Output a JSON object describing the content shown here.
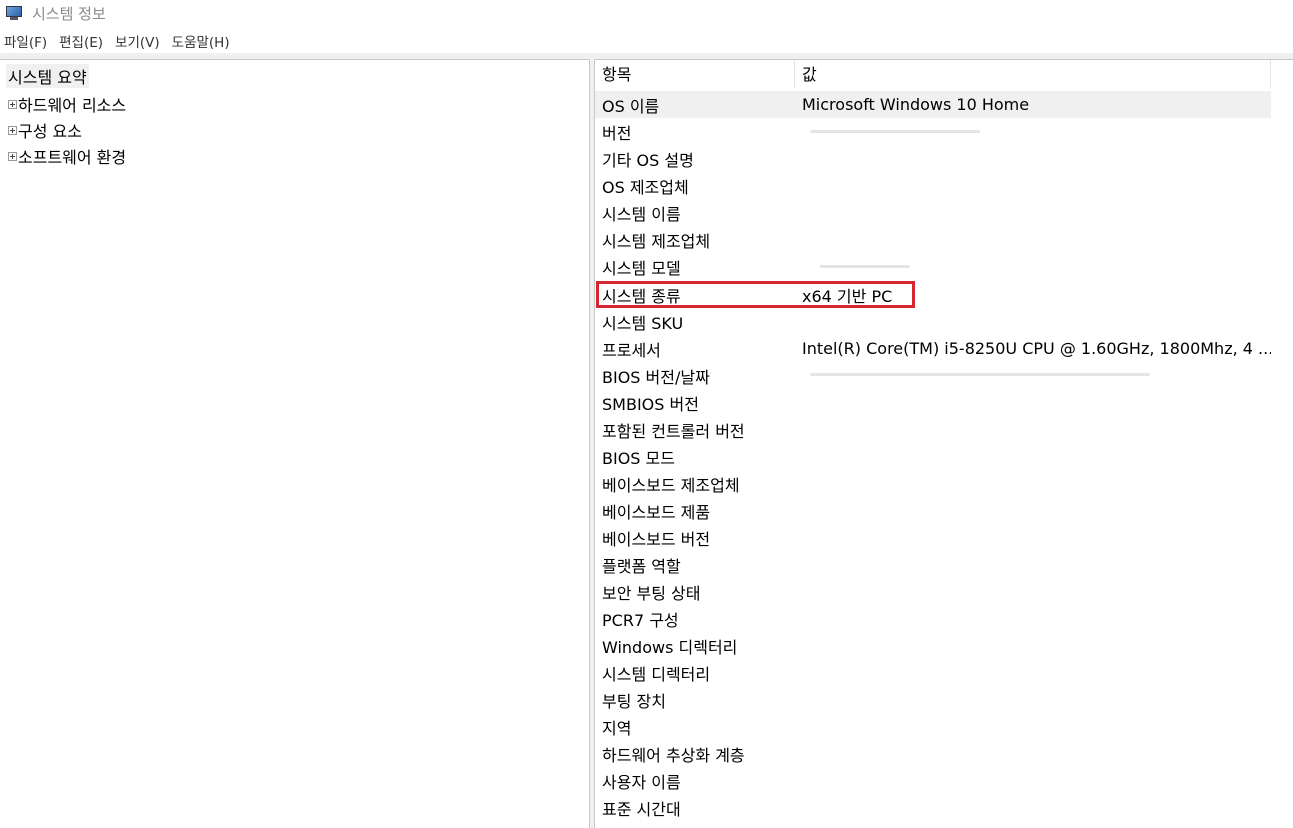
{
  "window": {
    "title": "시스템 정보",
    "icon": "computer-icon"
  },
  "menubar": {
    "items": [
      "파일(F)",
      "편집(E)",
      "보기(V)",
      "도움말(H)"
    ]
  },
  "tree": {
    "root": "시스템 요약",
    "nodes": [
      "하드웨어 리소스",
      "구성 요소",
      "소프트웨어 환경"
    ]
  },
  "table": {
    "columns": {
      "item": "항목",
      "value": "값"
    },
    "rows": [
      {
        "item": "OS 이름",
        "value": "Microsoft Windows 10 Home",
        "selected": true
      },
      {
        "item": "버전",
        "value": ""
      },
      {
        "item": "기타 OS 설명",
        "value": ""
      },
      {
        "item": "OS 제조업체",
        "value": ""
      },
      {
        "item": "시스템 이름",
        "value": ""
      },
      {
        "item": "시스템 제조업체",
        "value": ""
      },
      {
        "item": "시스템 모델",
        "value": ""
      },
      {
        "item": "시스템 종류",
        "value": "x64 기반 PC",
        "highlighted": true
      },
      {
        "item": "시스템 SKU",
        "value": ""
      },
      {
        "item": "프로세서",
        "value": "Intel(R) Core(TM) i5-8250U CPU @ 1.60GHz, 1800Mhz, 4 ..."
      },
      {
        "item": "BIOS 버전/날짜",
        "value": ""
      },
      {
        "item": "SMBIOS 버전",
        "value": ""
      },
      {
        "item": "포함된 컨트롤러 버전",
        "value": ""
      },
      {
        "item": "BIOS 모드",
        "value": ""
      },
      {
        "item": "베이스보드 제조업체",
        "value": ""
      },
      {
        "item": "베이스보드 제품",
        "value": ""
      },
      {
        "item": "베이스보드 버전",
        "value": ""
      },
      {
        "item": "플랫폼 역할",
        "value": ""
      },
      {
        "item": "보안 부팅 상태",
        "value": ""
      },
      {
        "item": "PCR7 구성",
        "value": ""
      },
      {
        "item": "Windows 디렉터리",
        "value": ""
      },
      {
        "item": "시스템 디렉터리",
        "value": ""
      },
      {
        "item": "부팅 장치",
        "value": ""
      },
      {
        "item": "지역",
        "value": ""
      },
      {
        "item": "하드웨어 추상화 계층",
        "value": ""
      },
      {
        "item": "사용자 이름",
        "value": ""
      },
      {
        "item": "표준 시간대",
        "value": ""
      }
    ]
  },
  "colors": {
    "highlight_border": "#d6262f",
    "selected_row_bg": "#f0f0f0"
  }
}
